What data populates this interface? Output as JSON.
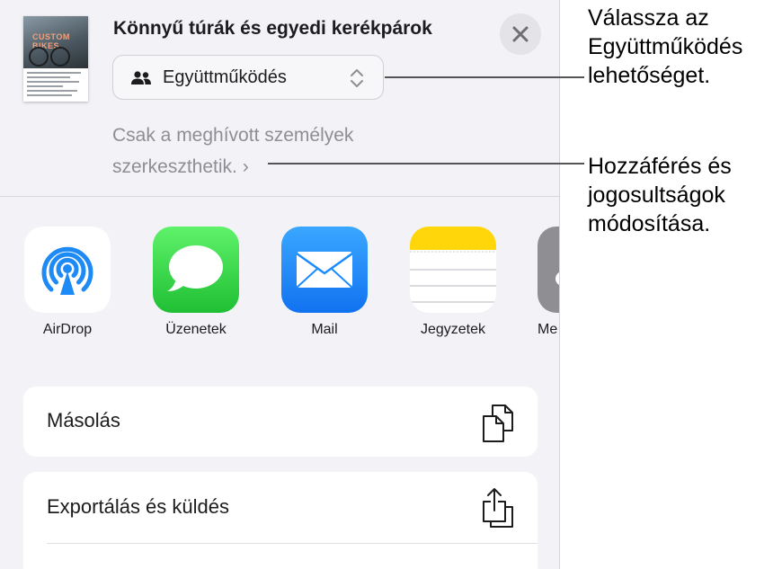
{
  "document": {
    "title": "Könnyű túrák és egyedi kerékpárok",
    "thumbnail_text": "CUSTOM BIKES"
  },
  "collaboration": {
    "selected": "Együttműködés",
    "permission_text": "Csak a meghívott személyek szerkeszthetik.",
    "permission_chevron": "›"
  },
  "share_apps": [
    {
      "name": "AirDrop",
      "icon": "airdrop-icon",
      "color": "#1e8af5"
    },
    {
      "name": "Üzenetek",
      "icon": "messages-icon",
      "color": "#2ecc40"
    },
    {
      "name": "Mail",
      "icon": "mail-icon",
      "color": "#1a8cff"
    },
    {
      "name": "Jegyzetek",
      "icon": "notes-icon",
      "color": "#ffd60a"
    },
    {
      "name": "Me…",
      "icon": "more-app-icon",
      "color": "#8e8e93"
    }
  ],
  "actions": [
    {
      "label": "Másolás",
      "icon": "copy-icon"
    },
    {
      "label": "Exportálás és küldés",
      "icon": "export-icon"
    }
  ],
  "callouts": {
    "collaboration": "Válassza az Együttműködés lehetőséget.",
    "access": "Hozzáférés és jogosultságok módosítása."
  }
}
